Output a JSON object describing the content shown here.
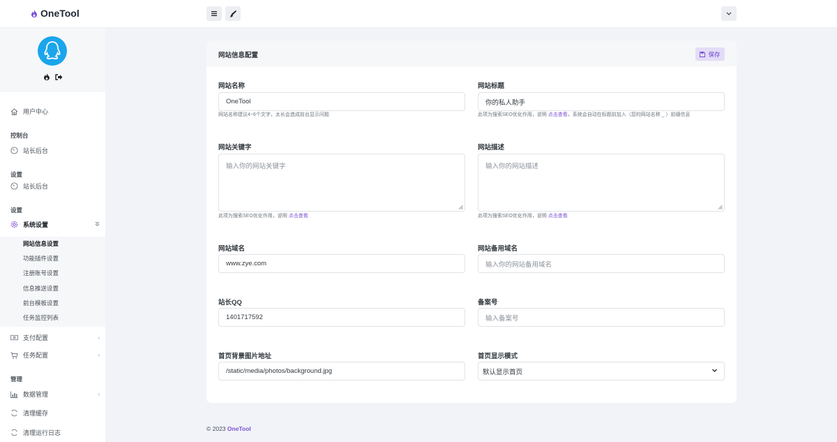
{
  "header": {
    "brand": "OneTool"
  },
  "sidebar": {
    "user_center": "用户中心",
    "section_console": "控制台",
    "console_item": "站长后台",
    "section_settings": "设置",
    "settings_item": "站长后台",
    "section_settings2": "设置",
    "system_settings": "系统设置",
    "sub_items": [
      "网站信息设置",
      "功能插件设置",
      "注册账号设置",
      "信息推送设置",
      "前台模板设置",
      "任务监控列表"
    ],
    "pay_config": "支付配置",
    "task_config": "任务配置",
    "section_manage": "管理",
    "data_manage": "数据管理",
    "clear_cache": "清理缓存",
    "clear_logs": "清理运行日志"
  },
  "card": {
    "title": "网站信息配置",
    "save_label": "保存"
  },
  "form": {
    "site_name": {
      "label": "网站名称",
      "value": "OneTool",
      "help": "网站名称建议4~6个文字，太长会造成前台显示问题"
    },
    "site_title": {
      "label": "网站标题",
      "value": "你的私人助手",
      "help_pre": "此项为搜索SEO优化作用，说明 ",
      "help_link": "点击查看",
      "help_post": "，系统会自动在标题前加入（您的网站名称 _ ）前缀信息"
    },
    "keywords": {
      "label": "网站关键字",
      "placeholder": "输入你的网站关键字",
      "help_pre": "此项为搜索SEO优化作用，说明 ",
      "help_link": "点击查看"
    },
    "description": {
      "label": "网站描述",
      "placeholder": "输入你的网站描述",
      "help_pre": "此项为搜索SEO优化作用，说明 ",
      "help_link": "点击查看"
    },
    "domain": {
      "label": "网站域名",
      "value": "www.zye.com"
    },
    "backup_domain": {
      "label": "网站备用域名",
      "placeholder": "输入你的网站备用域名"
    },
    "qq": {
      "label": "站长QQ",
      "value": "1401717592"
    },
    "icp": {
      "label": "备案号",
      "placeholder": "输入备案号"
    },
    "bg_image": {
      "label": "首页背景图片地址",
      "value": "/static/media/photos/background.jpg"
    },
    "display_mode": {
      "label": "首页显示模式",
      "value": "默认显示首页"
    }
  },
  "footer": {
    "copyright": "© 2023 ",
    "brand": "OneTool"
  },
  "colors": {
    "accent": "#7b52d6",
    "avatar_bg": "#1ba5ec"
  }
}
